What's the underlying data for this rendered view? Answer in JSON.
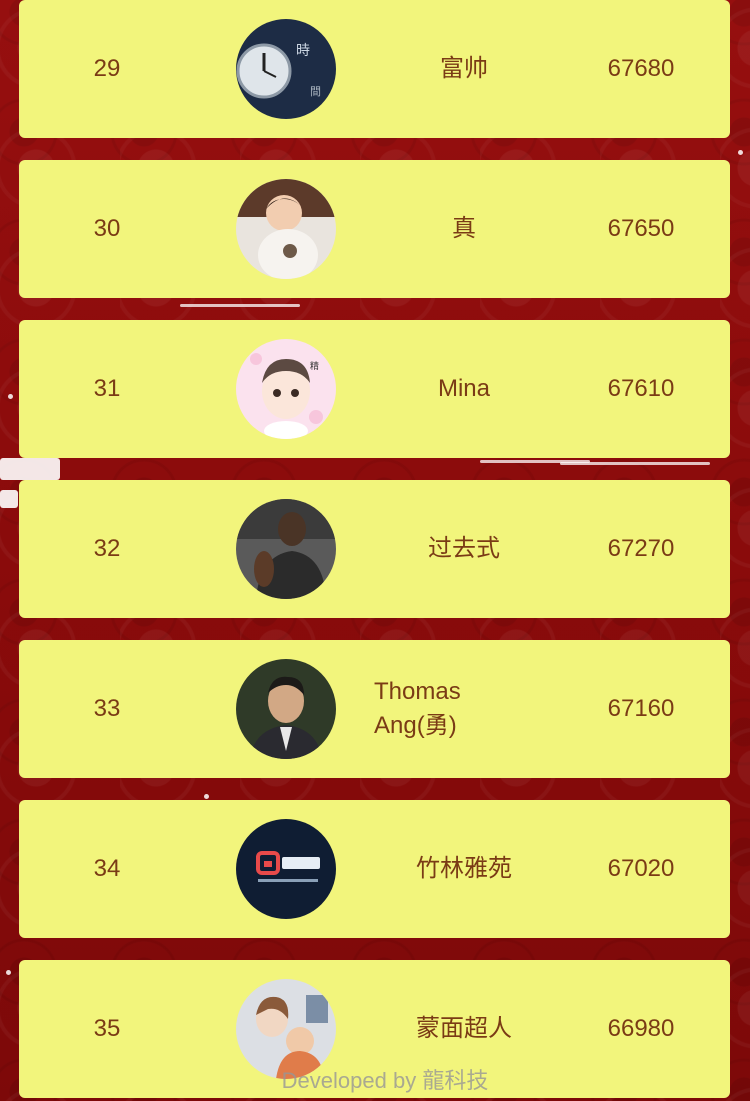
{
  "leaderboard": {
    "rows": [
      {
        "rank": "29",
        "name": "富帅",
        "score": "67680",
        "avatar_icon": "clock-avatar-icon"
      },
      {
        "rank": "30",
        "name": "真",
        "score": "67650",
        "avatar_icon": "baby-avatar-icon"
      },
      {
        "rank": "31",
        "name": "Mina",
        "score": "67610",
        "avatar_icon": "cartoon-boy-avatar-icon"
      },
      {
        "rank": "32",
        "name": "过去式",
        "score": "67270",
        "avatar_icon": "athlete-avatar-icon"
      },
      {
        "rank": "33",
        "name": "Thomas Ang(勇)",
        "score": "67160",
        "avatar_icon": "man-portrait-avatar-icon"
      },
      {
        "rank": "34",
        "name": "竹林雅苑",
        "score": "67020",
        "avatar_icon": "app-logo-avatar-icon"
      },
      {
        "rank": "35",
        "name": "蒙面超人",
        "score": "66980",
        "avatar_icon": "illustration-avatar-icon"
      }
    ]
  },
  "footer": {
    "text": "Developed by 龍科技"
  },
  "colors": {
    "background": "#8f0c0c",
    "card": "#f2f57c",
    "text": "#7a3b15"
  }
}
